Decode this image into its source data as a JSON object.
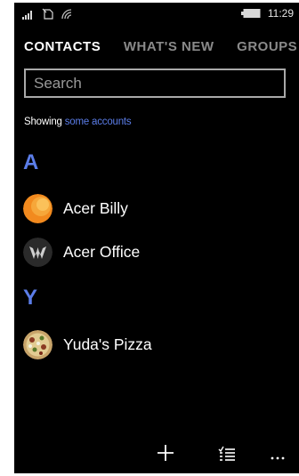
{
  "status_bar": {
    "time": "11:29",
    "icons": [
      "signal-icon",
      "no-sim-icon",
      "wifi-icon",
      "battery-icon"
    ]
  },
  "pivot": {
    "tabs": [
      {
        "label": "CONTACTS",
        "active": true
      },
      {
        "label": "WHAT'S NEW",
        "active": false
      },
      {
        "label": "GROUPS",
        "active": false
      }
    ]
  },
  "search": {
    "placeholder": "Search",
    "value": ""
  },
  "filter": {
    "prefix": "Showing",
    "link": "some accounts"
  },
  "groups": [
    {
      "letter": "A",
      "contacts": [
        {
          "name": "Acer Billy",
          "avatar": "orange-circle-avatar"
        },
        {
          "name": "Acer Office",
          "avatar": "acer-logo-avatar"
        }
      ]
    },
    {
      "letter": "Y",
      "contacts": [
        {
          "name": "Yuda's Pizza",
          "avatar": "pizza-avatar"
        }
      ]
    }
  ],
  "app_bar": {
    "buttons": [
      "add-icon",
      "select-list-icon",
      "more-icon"
    ]
  },
  "colors": {
    "background": "#000000",
    "accent": "#5b7de8",
    "text": "#ffffff",
    "inactive_tab": "#8a8a8a"
  }
}
